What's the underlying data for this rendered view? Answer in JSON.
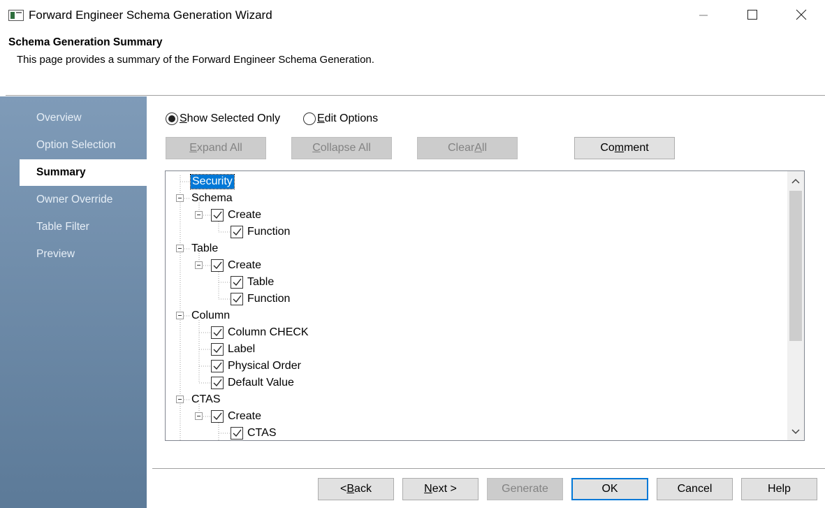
{
  "window": {
    "title": "Forward Engineer Schema Generation Wizard",
    "minimize_icon": "minimize-icon",
    "maximize_icon": "maximize-icon",
    "close_icon": "close-icon"
  },
  "header": {
    "title": "Schema Generation Summary",
    "description": "This page provides a summary of the Forward Engineer Schema Generation."
  },
  "sidebar": {
    "items": [
      {
        "label": "Overview"
      },
      {
        "label": "Option Selection"
      },
      {
        "label": "Summary",
        "active": true
      },
      {
        "label": "Owner Override"
      },
      {
        "label": "Table Filter"
      },
      {
        "label": "Preview"
      }
    ]
  },
  "view_mode": {
    "show_selected_only": {
      "pre": "",
      "key": "S",
      "post": "how Selected Only",
      "checked": true
    },
    "edit_options": {
      "pre": "",
      "key": "E",
      "post": "dit Options",
      "checked": false
    }
  },
  "tree_buttons": {
    "expand_all": {
      "pre": "",
      "key": "E",
      "post": "xpand All",
      "enabled": false
    },
    "collapse_all": {
      "pre": "",
      "key": "C",
      "post": "ollapse All",
      "enabled": false
    },
    "clear_all": {
      "pre": "Clear ",
      "key": "A",
      "post": "ll",
      "enabled": false
    },
    "comment": {
      "pre": "Co",
      "key": "m",
      "post": "ment",
      "enabled": true
    }
  },
  "tree": {
    "nodes": [
      {
        "label": "Security",
        "level": 0,
        "selected": true
      },
      {
        "label": "Schema",
        "level": 0,
        "expanded": true
      },
      {
        "label": "Create",
        "level": 1,
        "checked": true,
        "expanded": true
      },
      {
        "label": "Function",
        "level": 2,
        "checked": true
      },
      {
        "label": "Table",
        "level": 0,
        "expanded": true
      },
      {
        "label": "Create",
        "level": 1,
        "checked": true,
        "expanded": true
      },
      {
        "label": "Table",
        "level": 2,
        "checked": true
      },
      {
        "label": "Function",
        "level": 2,
        "checked": true
      },
      {
        "label": "Column",
        "level": 0,
        "expanded": true
      },
      {
        "label": "Column CHECK",
        "level": 1,
        "checked": true
      },
      {
        "label": "Label",
        "level": 1,
        "checked": true
      },
      {
        "label": "Physical Order",
        "level": 1,
        "checked": true
      },
      {
        "label": "Default Value",
        "level": 1,
        "checked": true
      },
      {
        "label": "CTAS",
        "level": 0,
        "expanded": true
      },
      {
        "label": "Create",
        "level": 1,
        "checked": true,
        "expanded": true
      },
      {
        "label": "CTAS",
        "level": 2,
        "checked": true
      }
    ]
  },
  "footer": {
    "back": {
      "pre": "< ",
      "key": "B",
      "post": "ack",
      "enabled": true
    },
    "next": {
      "pre": "",
      "key": "N",
      "post": "ext >",
      "enabled": true
    },
    "generate": {
      "pre": "Generate",
      "key": "",
      "post": "",
      "enabled": false
    },
    "ok": {
      "pre": "OK",
      "key": "",
      "post": "",
      "enabled": true,
      "default": true
    },
    "cancel": {
      "pre": "Cancel",
      "key": "",
      "post": "",
      "enabled": true
    },
    "help": {
      "pre": "Help",
      "key": "",
      "post": "",
      "enabled": true
    }
  },
  "colors": {
    "sidebar_top": "#7f9bb8",
    "sidebar_bottom": "#5c7a98",
    "selection": "#0078d7",
    "default_button_border": "#0078d7"
  }
}
